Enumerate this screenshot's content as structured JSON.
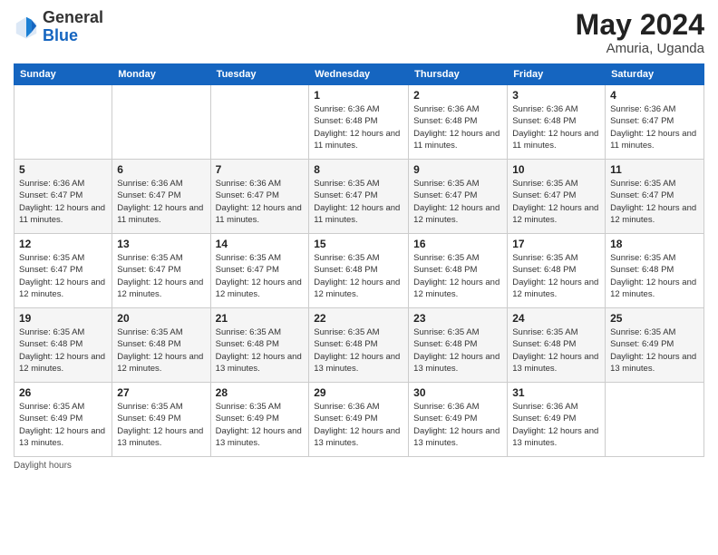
{
  "header": {
    "logo_general": "General",
    "logo_blue": "Blue",
    "month_year": "May 2024",
    "location": "Amuria, Uganda"
  },
  "days_of_week": [
    "Sunday",
    "Monday",
    "Tuesday",
    "Wednesday",
    "Thursday",
    "Friday",
    "Saturday"
  ],
  "weeks": [
    [
      {
        "day": "",
        "info": ""
      },
      {
        "day": "",
        "info": ""
      },
      {
        "day": "",
        "info": ""
      },
      {
        "day": "1",
        "info": "Sunrise: 6:36 AM\nSunset: 6:48 PM\nDaylight: 12 hours and 11 minutes."
      },
      {
        "day": "2",
        "info": "Sunrise: 6:36 AM\nSunset: 6:48 PM\nDaylight: 12 hours and 11 minutes."
      },
      {
        "day": "3",
        "info": "Sunrise: 6:36 AM\nSunset: 6:48 PM\nDaylight: 12 hours and 11 minutes."
      },
      {
        "day": "4",
        "info": "Sunrise: 6:36 AM\nSunset: 6:47 PM\nDaylight: 12 hours and 11 minutes."
      }
    ],
    [
      {
        "day": "5",
        "info": "Sunrise: 6:36 AM\nSunset: 6:47 PM\nDaylight: 12 hours and 11 minutes."
      },
      {
        "day": "6",
        "info": "Sunrise: 6:36 AM\nSunset: 6:47 PM\nDaylight: 12 hours and 11 minutes."
      },
      {
        "day": "7",
        "info": "Sunrise: 6:36 AM\nSunset: 6:47 PM\nDaylight: 12 hours and 11 minutes."
      },
      {
        "day": "8",
        "info": "Sunrise: 6:35 AM\nSunset: 6:47 PM\nDaylight: 12 hours and 11 minutes."
      },
      {
        "day": "9",
        "info": "Sunrise: 6:35 AM\nSunset: 6:47 PM\nDaylight: 12 hours and 12 minutes."
      },
      {
        "day": "10",
        "info": "Sunrise: 6:35 AM\nSunset: 6:47 PM\nDaylight: 12 hours and 12 minutes."
      },
      {
        "day": "11",
        "info": "Sunrise: 6:35 AM\nSunset: 6:47 PM\nDaylight: 12 hours and 12 minutes."
      }
    ],
    [
      {
        "day": "12",
        "info": "Sunrise: 6:35 AM\nSunset: 6:47 PM\nDaylight: 12 hours and 12 minutes."
      },
      {
        "day": "13",
        "info": "Sunrise: 6:35 AM\nSunset: 6:47 PM\nDaylight: 12 hours and 12 minutes."
      },
      {
        "day": "14",
        "info": "Sunrise: 6:35 AM\nSunset: 6:47 PM\nDaylight: 12 hours and 12 minutes."
      },
      {
        "day": "15",
        "info": "Sunrise: 6:35 AM\nSunset: 6:48 PM\nDaylight: 12 hours and 12 minutes."
      },
      {
        "day": "16",
        "info": "Sunrise: 6:35 AM\nSunset: 6:48 PM\nDaylight: 12 hours and 12 minutes."
      },
      {
        "day": "17",
        "info": "Sunrise: 6:35 AM\nSunset: 6:48 PM\nDaylight: 12 hours and 12 minutes."
      },
      {
        "day": "18",
        "info": "Sunrise: 6:35 AM\nSunset: 6:48 PM\nDaylight: 12 hours and 12 minutes."
      }
    ],
    [
      {
        "day": "19",
        "info": "Sunrise: 6:35 AM\nSunset: 6:48 PM\nDaylight: 12 hours and 12 minutes."
      },
      {
        "day": "20",
        "info": "Sunrise: 6:35 AM\nSunset: 6:48 PM\nDaylight: 12 hours and 12 minutes."
      },
      {
        "day": "21",
        "info": "Sunrise: 6:35 AM\nSunset: 6:48 PM\nDaylight: 12 hours and 13 minutes."
      },
      {
        "day": "22",
        "info": "Sunrise: 6:35 AM\nSunset: 6:48 PM\nDaylight: 12 hours and 13 minutes."
      },
      {
        "day": "23",
        "info": "Sunrise: 6:35 AM\nSunset: 6:48 PM\nDaylight: 12 hours and 13 minutes."
      },
      {
        "day": "24",
        "info": "Sunrise: 6:35 AM\nSunset: 6:48 PM\nDaylight: 12 hours and 13 minutes."
      },
      {
        "day": "25",
        "info": "Sunrise: 6:35 AM\nSunset: 6:49 PM\nDaylight: 12 hours and 13 minutes."
      }
    ],
    [
      {
        "day": "26",
        "info": "Sunrise: 6:35 AM\nSunset: 6:49 PM\nDaylight: 12 hours and 13 minutes."
      },
      {
        "day": "27",
        "info": "Sunrise: 6:35 AM\nSunset: 6:49 PM\nDaylight: 12 hours and 13 minutes."
      },
      {
        "day": "28",
        "info": "Sunrise: 6:35 AM\nSunset: 6:49 PM\nDaylight: 12 hours and 13 minutes."
      },
      {
        "day": "29",
        "info": "Sunrise: 6:36 AM\nSunset: 6:49 PM\nDaylight: 12 hours and 13 minutes."
      },
      {
        "day": "30",
        "info": "Sunrise: 6:36 AM\nSunset: 6:49 PM\nDaylight: 12 hours and 13 minutes."
      },
      {
        "day": "31",
        "info": "Sunrise: 6:36 AM\nSunset: 6:49 PM\nDaylight: 12 hours and 13 minutes."
      },
      {
        "day": "",
        "info": ""
      }
    ]
  ],
  "footer": {
    "daylight_label": "Daylight hours"
  }
}
